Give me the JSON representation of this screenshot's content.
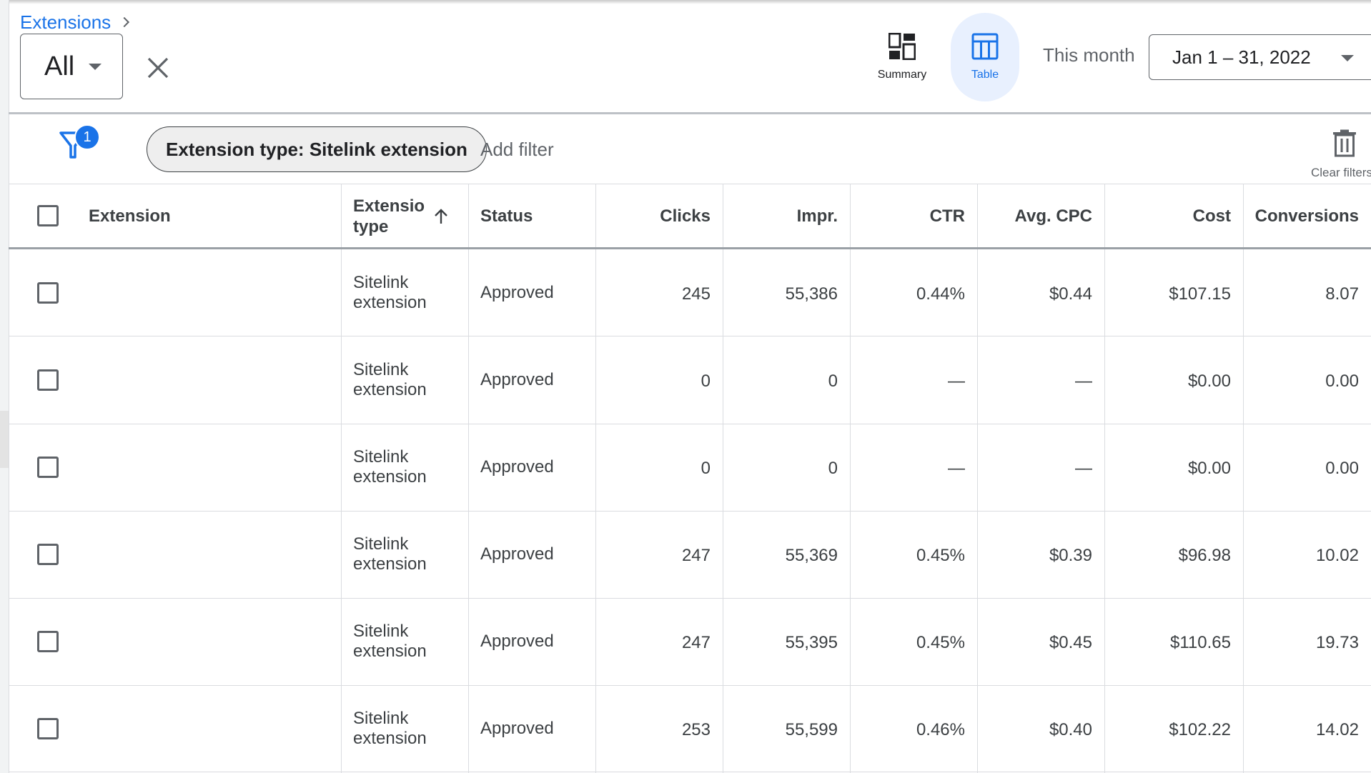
{
  "breadcrumb": {
    "label": "Extensions"
  },
  "scope": {
    "value": "All"
  },
  "views": {
    "summary_label": "Summary",
    "table_label": "Table",
    "active": "Table",
    "accent": "#1a73e8"
  },
  "date_range": {
    "label": "This month",
    "value": "Jan 1 – 31, 2022"
  },
  "filters": {
    "count": "1",
    "chips": [
      {
        "label": "Extension type: Sitelink extension"
      }
    ],
    "add_label": "Add filter",
    "clear_label": "Clear filters"
  },
  "table": {
    "columns": {
      "extension": "Extension",
      "type_line1": "Extensio",
      "type_line2": "type",
      "status": "Status",
      "clicks": "Clicks",
      "impr": "Impr.",
      "ctr": "CTR",
      "avg_cpc": "Avg. CPC",
      "cost": "Cost",
      "conversions": "Conversions"
    },
    "sort": {
      "column": "Extension type",
      "direction": "ascending"
    },
    "rows": [
      {
        "type_line1": "Sitelink",
        "type_line2": "extension",
        "status": "Approved",
        "clicks": "245",
        "impr": "55,386",
        "ctr": "0.44%",
        "avg_cpc": "$0.44",
        "cost": "$107.15",
        "conversions": "8.07"
      },
      {
        "type_line1": "Sitelink",
        "type_line2": "extension",
        "status": "Approved",
        "clicks": "0",
        "impr": "0",
        "ctr": "—",
        "avg_cpc": "—",
        "cost": "$0.00",
        "conversions": "0.00"
      },
      {
        "type_line1": "Sitelink",
        "type_line2": "extension",
        "status": "Approved",
        "clicks": "0",
        "impr": "0",
        "ctr": "—",
        "avg_cpc": "—",
        "cost": "$0.00",
        "conversions": "0.00"
      },
      {
        "type_line1": "Sitelink",
        "type_line2": "extension",
        "status": "Approved",
        "clicks": "247",
        "impr": "55,369",
        "ctr": "0.45%",
        "avg_cpc": "$0.39",
        "cost": "$96.98",
        "conversions": "10.02"
      },
      {
        "type_line1": "Sitelink",
        "type_line2": "extension",
        "status": "Approved",
        "clicks": "247",
        "impr": "55,395",
        "ctr": "0.45%",
        "avg_cpc": "$0.45",
        "cost": "$110.65",
        "conversions": "19.73"
      },
      {
        "type_line1": "Sitelink",
        "type_line2": "extension",
        "status": "Approved",
        "clicks": "253",
        "impr": "55,599",
        "ctr": "0.46%",
        "avg_cpc": "$0.40",
        "cost": "$102.22",
        "conversions": "14.02"
      }
    ]
  }
}
